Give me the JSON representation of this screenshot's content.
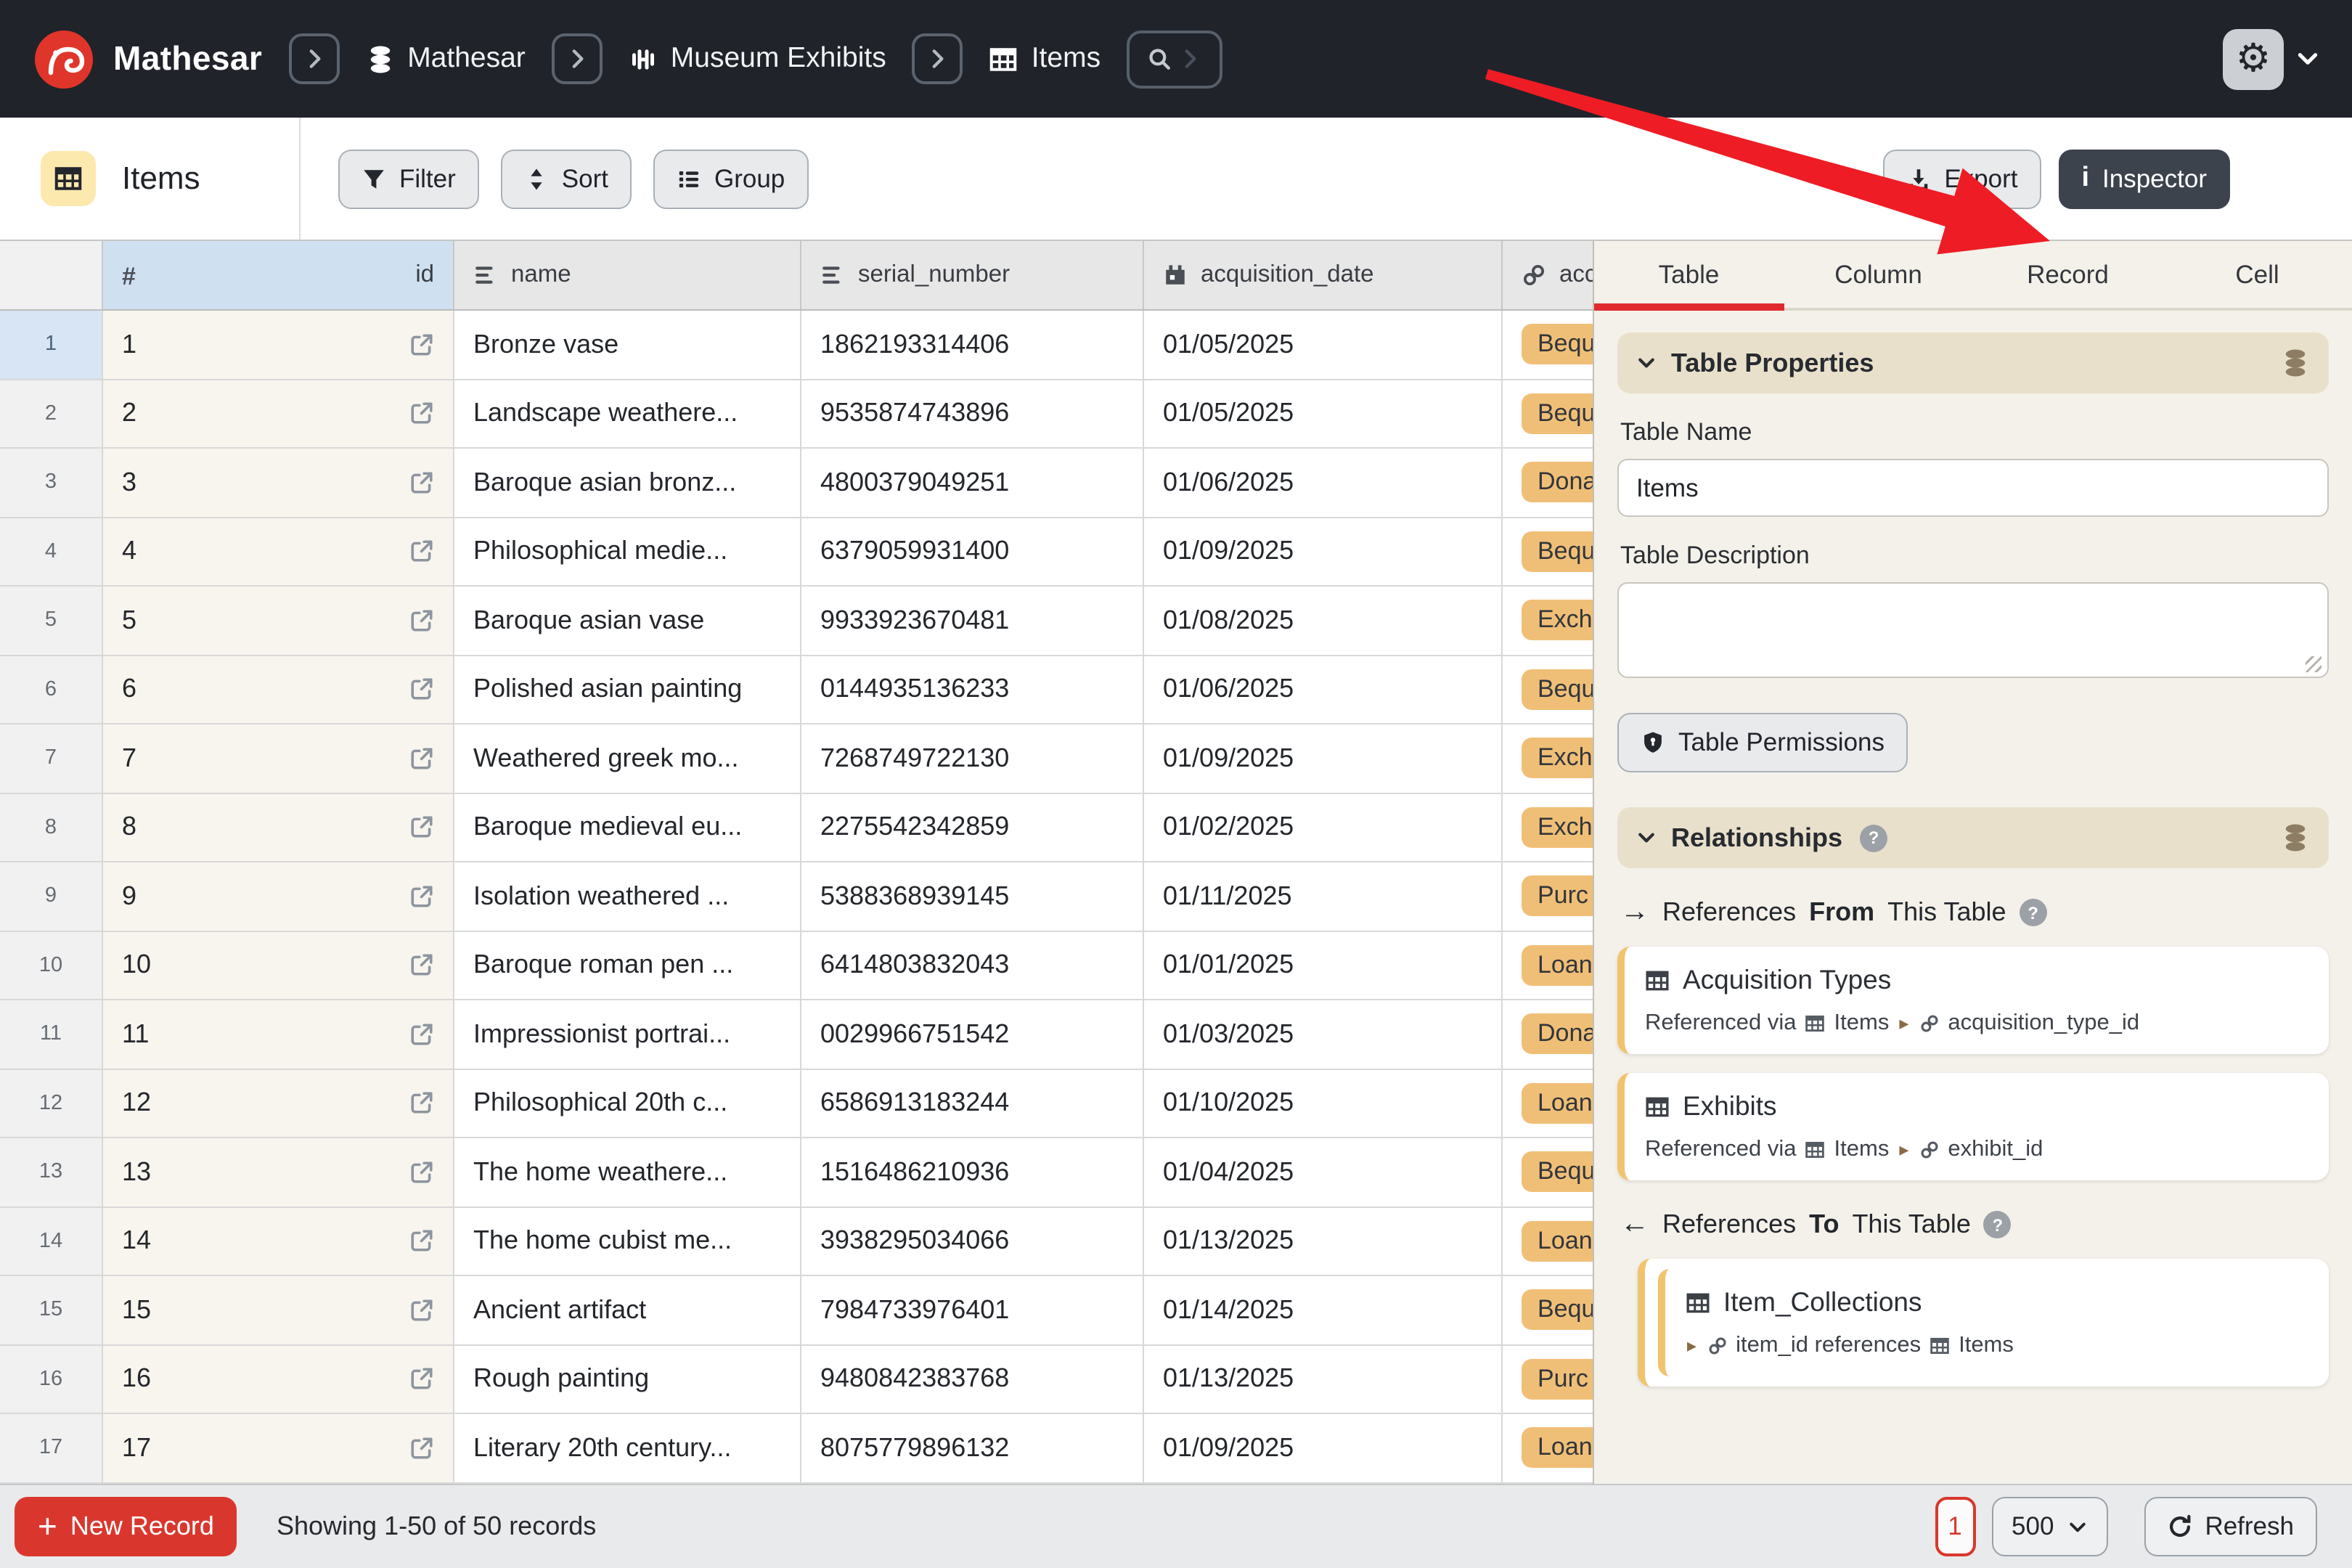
{
  "header": {
    "brand": "Mathesar",
    "breadcrumb": {
      "database": "Mathesar",
      "schema": "Museum Exhibits",
      "table": "Items"
    }
  },
  "toolbar": {
    "title": "Items",
    "filter_label": "Filter",
    "sort_label": "Sort",
    "group_label": "Group",
    "export_label": "Export",
    "inspector_label": "Inspector"
  },
  "table": {
    "columns": [
      {
        "key": "id",
        "label": "id",
        "icon": "hash-icon"
      },
      {
        "key": "name",
        "label": "name",
        "icon": "text-icon"
      },
      {
        "key": "serial_number",
        "label": "serial_number",
        "icon": "text-icon"
      },
      {
        "key": "acquisition_date",
        "label": "acquisition_date",
        "icon": "calendar-icon"
      },
      {
        "key": "acquisition_type",
        "label": "acc",
        "icon": "link-icon"
      }
    ],
    "rows": [
      {
        "row_number": 1,
        "id": "1",
        "name": "Bronze vase",
        "serial_number": "1862193314406",
        "acquisition_date": "01/05/2025",
        "acquisition_type": "Bequ"
      },
      {
        "row_number": 2,
        "id": "2",
        "name": "Landscape weathere...",
        "serial_number": "9535874743896",
        "acquisition_date": "01/05/2025",
        "acquisition_type": "Bequ"
      },
      {
        "row_number": 3,
        "id": "3",
        "name": "Baroque asian bronz...",
        "serial_number": "4800379049251",
        "acquisition_date": "01/06/2025",
        "acquisition_type": "Dona"
      },
      {
        "row_number": 4,
        "id": "4",
        "name": "Philosophical medie...",
        "serial_number": "6379059931400",
        "acquisition_date": "01/09/2025",
        "acquisition_type": "Bequ"
      },
      {
        "row_number": 5,
        "id": "5",
        "name": "Baroque asian vase",
        "serial_number": "9933923670481",
        "acquisition_date": "01/08/2025",
        "acquisition_type": "Exch"
      },
      {
        "row_number": 6,
        "id": "6",
        "name": "Polished asian painting",
        "serial_number": "0144935136233",
        "acquisition_date": "01/06/2025",
        "acquisition_type": "Bequ"
      },
      {
        "row_number": 7,
        "id": "7",
        "name": "Weathered greek mo...",
        "serial_number": "7268749722130",
        "acquisition_date": "01/09/2025",
        "acquisition_type": "Exch"
      },
      {
        "row_number": 8,
        "id": "8",
        "name": "Baroque medieval eu...",
        "serial_number": "2275542342859",
        "acquisition_date": "01/02/2025",
        "acquisition_type": "Exch"
      },
      {
        "row_number": 9,
        "id": "9",
        "name": "Isolation weathered ...",
        "serial_number": "5388368939145",
        "acquisition_date": "01/11/2025",
        "acquisition_type": "Purc"
      },
      {
        "row_number": 10,
        "id": "10",
        "name": "Baroque roman pen ...",
        "serial_number": "6414803832043",
        "acquisition_date": "01/01/2025",
        "acquisition_type": "Loan"
      },
      {
        "row_number": 11,
        "id": "11",
        "name": "Impressionist portrai...",
        "serial_number": "0029966751542",
        "acquisition_date": "01/03/2025",
        "acquisition_type": "Dona"
      },
      {
        "row_number": 12,
        "id": "12",
        "name": "Philosophical 20th c...",
        "serial_number": "6586913183244",
        "acquisition_date": "01/10/2025",
        "acquisition_type": "Loan"
      },
      {
        "row_number": 13,
        "id": "13",
        "name": "The home weathere...",
        "serial_number": "1516486210936",
        "acquisition_date": "01/04/2025",
        "acquisition_type": "Bequ"
      },
      {
        "row_number": 14,
        "id": "14",
        "name": "The home cubist me...",
        "serial_number": "3938295034066",
        "acquisition_date": "01/13/2025",
        "acquisition_type": "Loan"
      },
      {
        "row_number": 15,
        "id": "15",
        "name": "Ancient artifact",
        "serial_number": "7984733976401",
        "acquisition_date": "01/14/2025",
        "acquisition_type": "Bequ"
      },
      {
        "row_number": 16,
        "id": "16",
        "name": "Rough painting",
        "serial_number": "9480842383768",
        "acquisition_date": "01/13/2025",
        "acquisition_type": "Purc"
      },
      {
        "row_number": 17,
        "id": "17",
        "name": "Literary 20th century...",
        "serial_number": "8075779896132",
        "acquisition_date": "01/09/2025",
        "acquisition_type": "Loan"
      }
    ]
  },
  "inspector": {
    "tabs": [
      "Table",
      "Column",
      "Record",
      "Cell"
    ],
    "active_tab": "Table",
    "table_properties": {
      "section_title": "Table Properties",
      "table_name_label": "Table Name",
      "table_name_value": "Items",
      "table_description_label": "Table Description",
      "table_description_value": "",
      "permissions_label": "Table Permissions"
    },
    "relationships": {
      "section_title": "Relationships",
      "from_heading": {
        "prefix": "References",
        "bold": "From",
        "suffix": "This Table"
      },
      "to_heading": {
        "prefix": "References",
        "bold": "To",
        "suffix": "This Table"
      },
      "from_cards": [
        {
          "table": "Acquisition Types",
          "via_prefix": "Referenced via",
          "via_table": "Items",
          "via_column": "acquisition_type_id"
        },
        {
          "table": "Exhibits",
          "via_prefix": "Referenced via",
          "via_table": "Items",
          "via_column": "exhibit_id"
        }
      ],
      "to_cards": [
        {
          "table": "Item_Collections",
          "column_text": "item_id references",
          "ref_table": "Items"
        }
      ]
    }
  },
  "statusbar": {
    "new_record_label": "New Record",
    "record_count_text": "Showing 1-50 of 50 records",
    "page_number": "1",
    "page_size": "500",
    "refresh_label": "Refresh"
  },
  "colors": {
    "header_bg": "#20232a",
    "accent_red": "#d9372e",
    "arrow_red": "#ee1c25",
    "badge_bg": "#f0bf77",
    "tab_underline": "#e02a2e",
    "selected_header_bg": "#cfe0f1",
    "selected_rownum_bg": "#d7e5f4",
    "panel_bg": "#f4f1ea",
    "section_bg": "#e9e0cb",
    "card_accent": "#f2c36f",
    "yellow_icon_bg": "#fce9ae",
    "id_cell_bg": "#f8f5ee",
    "inspector_btn_bg": "#3d434c"
  }
}
